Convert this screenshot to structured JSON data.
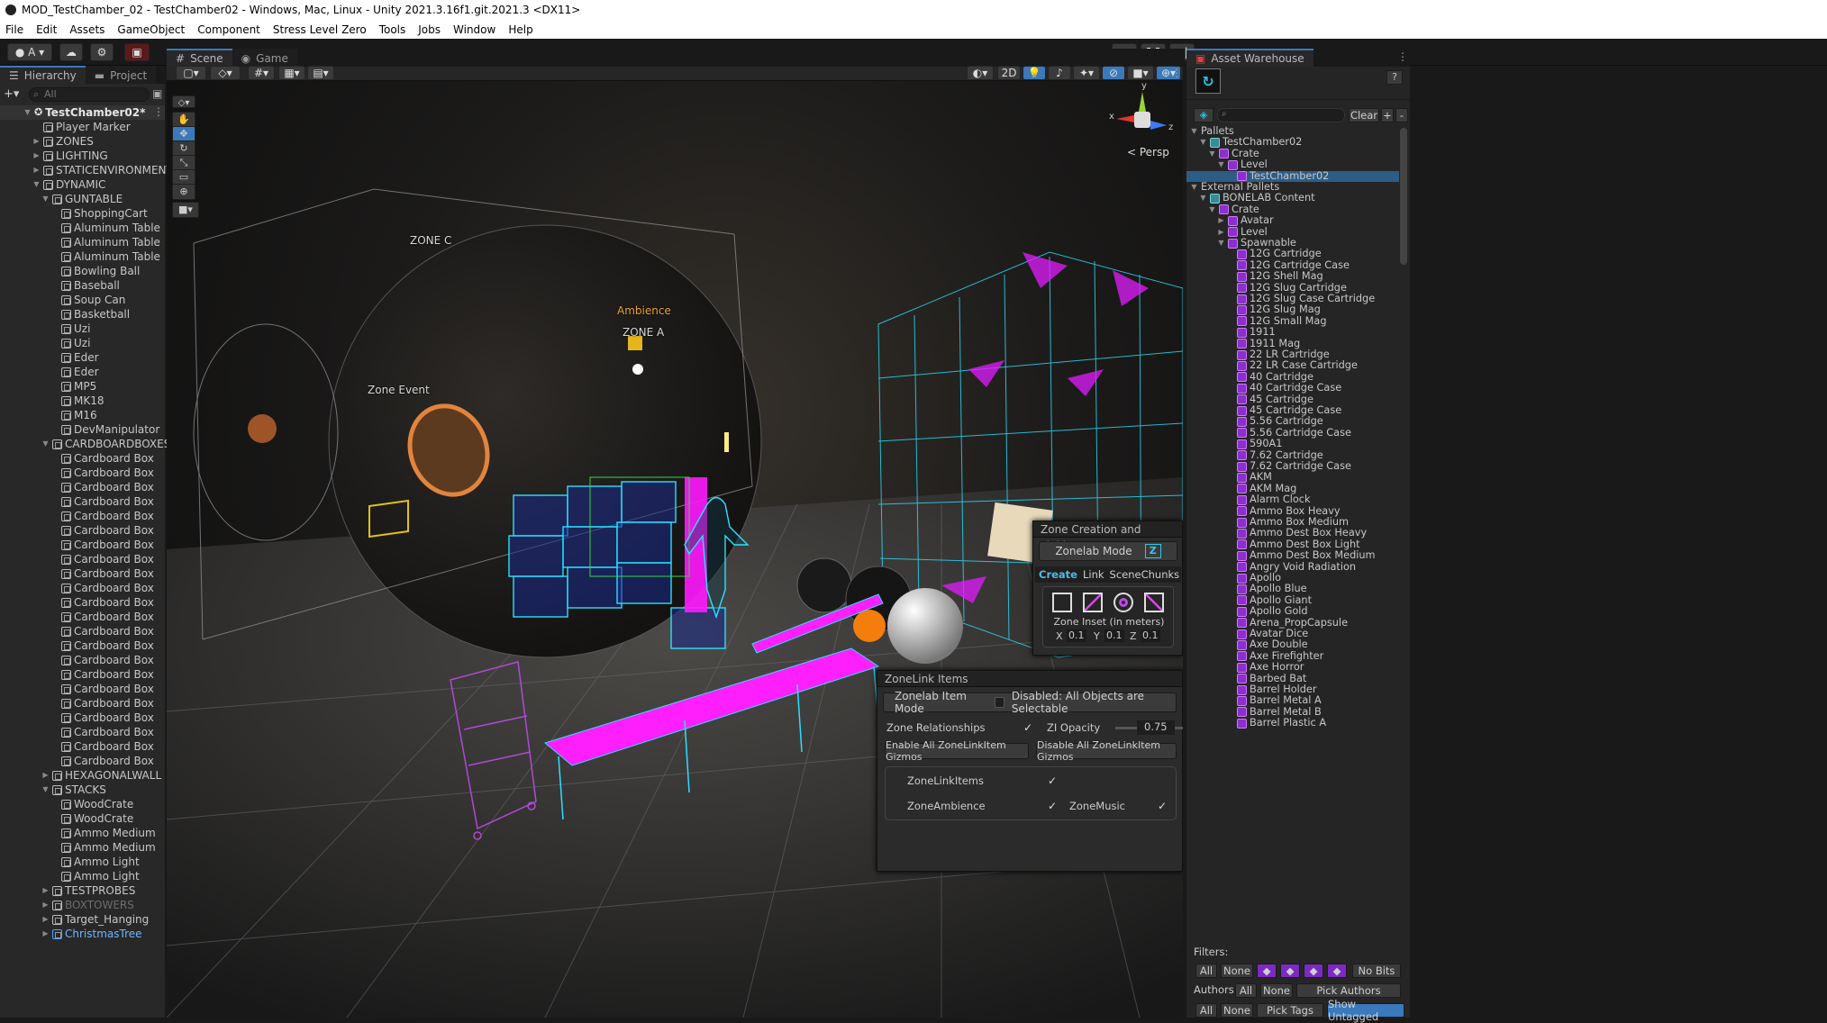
{
  "window": {
    "title": "MOD_TestChamber_02 - TestChamber02 - Windows, Mac, Linux - Unity 2021.3.16f1.git.2021.3 <DX11>"
  },
  "menu": [
    "File",
    "Edit",
    "Assets",
    "GameObject",
    "Component",
    "Stress Level Zero",
    "Tools",
    "Jobs",
    "Window",
    "Help"
  ],
  "toolbar": {
    "account": "A",
    "play": "▶",
    "pause": "❚❚",
    "step": "▶|"
  },
  "left_tabs": {
    "hierarchy": "Hierarchy",
    "project": "Project"
  },
  "hierarchy": {
    "search_placeholder": "All",
    "root": "TestChamber02*",
    "items": [
      {
        "label": "Player Marker",
        "depth": 1,
        "exp": ""
      },
      {
        "label": "ZONES",
        "depth": 1,
        "exp": "▶"
      },
      {
        "label": "LIGHTING",
        "depth": 1,
        "exp": "▶"
      },
      {
        "label": "STATICENVIRONMENT",
        "depth": 1,
        "exp": "▶"
      },
      {
        "label": "DYNAMIC",
        "depth": 1,
        "exp": "▼"
      },
      {
        "label": "GUNTABLE",
        "depth": 2,
        "exp": "▼"
      },
      {
        "label": "ShoppingCart",
        "depth": 3,
        "exp": ""
      },
      {
        "label": "Aluminum Table",
        "depth": 3,
        "exp": ""
      },
      {
        "label": "Aluminum Table",
        "depth": 3,
        "exp": ""
      },
      {
        "label": "Aluminum Table",
        "depth": 3,
        "exp": ""
      },
      {
        "label": "Bowling Ball",
        "depth": 3,
        "exp": ""
      },
      {
        "label": "Baseball",
        "depth": 3,
        "exp": ""
      },
      {
        "label": "Soup Can",
        "depth": 3,
        "exp": ""
      },
      {
        "label": "Basketball",
        "depth": 3,
        "exp": ""
      },
      {
        "label": "Uzi",
        "depth": 3,
        "exp": ""
      },
      {
        "label": "Uzi",
        "depth": 3,
        "exp": ""
      },
      {
        "label": "Eder",
        "depth": 3,
        "exp": ""
      },
      {
        "label": "Eder",
        "depth": 3,
        "exp": ""
      },
      {
        "label": "MP5",
        "depth": 3,
        "exp": ""
      },
      {
        "label": "MK18",
        "depth": 3,
        "exp": ""
      },
      {
        "label": "M16",
        "depth": 3,
        "exp": ""
      },
      {
        "label": "DevManipulator",
        "depth": 3,
        "exp": ""
      },
      {
        "label": "CARDBOARDBOXES",
        "depth": 2,
        "exp": "▼"
      },
      {
        "label": "Cardboard Box",
        "depth": 3,
        "exp": ""
      },
      {
        "label": "Cardboard Box",
        "depth": 3,
        "exp": ""
      },
      {
        "label": "Cardboard Box",
        "depth": 3,
        "exp": ""
      },
      {
        "label": "Cardboard Box",
        "depth": 3,
        "exp": ""
      },
      {
        "label": "Cardboard Box",
        "depth": 3,
        "exp": ""
      },
      {
        "label": "Cardboard Box",
        "depth": 3,
        "exp": ""
      },
      {
        "label": "Cardboard Box",
        "depth": 3,
        "exp": ""
      },
      {
        "label": "Cardboard Box",
        "depth": 3,
        "exp": ""
      },
      {
        "label": "Cardboard Box",
        "depth": 3,
        "exp": ""
      },
      {
        "label": "Cardboard Box",
        "depth": 3,
        "exp": ""
      },
      {
        "label": "Cardboard Box",
        "depth": 3,
        "exp": ""
      },
      {
        "label": "Cardboard Box",
        "depth": 3,
        "exp": ""
      },
      {
        "label": "Cardboard Box",
        "depth": 3,
        "exp": ""
      },
      {
        "label": "Cardboard Box",
        "depth": 3,
        "exp": ""
      },
      {
        "label": "Cardboard Box",
        "depth": 3,
        "exp": ""
      },
      {
        "label": "Cardboard Box",
        "depth": 3,
        "exp": ""
      },
      {
        "label": "Cardboard Box",
        "depth": 3,
        "exp": ""
      },
      {
        "label": "Cardboard Box",
        "depth": 3,
        "exp": ""
      },
      {
        "label": "Cardboard Box",
        "depth": 3,
        "exp": ""
      },
      {
        "label": "Cardboard Box",
        "depth": 3,
        "exp": ""
      },
      {
        "label": "Cardboard Box",
        "depth": 3,
        "exp": ""
      },
      {
        "label": "Cardboard Box",
        "depth": 3,
        "exp": ""
      },
      {
        "label": "HEXAGONALWALL",
        "depth": 2,
        "exp": "▶"
      },
      {
        "label": "STACKS",
        "depth": 2,
        "exp": "▼"
      },
      {
        "label": "WoodCrate",
        "depth": 3,
        "exp": ""
      },
      {
        "label": "WoodCrate",
        "depth": 3,
        "exp": ""
      },
      {
        "label": "Ammo Medium",
        "depth": 3,
        "exp": ""
      },
      {
        "label": "Ammo Medium",
        "depth": 3,
        "exp": ""
      },
      {
        "label": "Ammo Light",
        "depth": 3,
        "exp": ""
      },
      {
        "label": "Ammo Light",
        "depth": 3,
        "exp": ""
      },
      {
        "label": "TESTPROBES",
        "depth": 2,
        "exp": "▶"
      },
      {
        "label": "BOXTOWERS",
        "depth": 2,
        "exp": "▶",
        "dim": true
      },
      {
        "label": "Target_Hanging",
        "depth": 2,
        "exp": "▶"
      },
      {
        "label": "ChristmasTree",
        "depth": 2,
        "exp": "▶",
        "blue": true
      }
    ]
  },
  "center_tabs": {
    "scene": "Scene",
    "game": "Game"
  },
  "scene_toolbar": {
    "mode2d": "2D"
  },
  "scene_labels": {
    "zone_c": "ZONE C",
    "ambience": "Ambience",
    "zone_a": "ZONE A",
    "zone_event": "Zone Event",
    "persp": "< Persp"
  },
  "gizmo_axes": {
    "x": "x",
    "y": "y",
    "z": "z"
  },
  "zone_creation": {
    "title": "Zone Creation and Linking",
    "mode_button": "Zonelab Mode",
    "tabs": [
      "Create",
      "Link",
      "SceneChunks"
    ],
    "inset_label": "Zone Inset (in meters)",
    "x_label": "X",
    "x_value": "0.1",
    "y_label": "Y",
    "y_value": "0.1",
    "z_label": "Z",
    "z_value": "0.1"
  },
  "zonelink": {
    "title": "ZoneLink Items",
    "item_mode_button": "Zonelab Item Mode",
    "disabled_text": "Disabled: All Objects are Selectable",
    "relationships_label": "Zone Relationships",
    "opacity_label": "ZI Opacity",
    "opacity_value": "0.75",
    "opacity_fraction": 0.75,
    "enable_button": "Enable All ZoneLinkItem Gizmos",
    "disable_button": "Disable All ZoneLinkItem Gizmos",
    "items_label": "ZoneLinkItems",
    "ambience_label": "ZoneAmbience",
    "music_label": "ZoneMusic"
  },
  "asset_warehouse": {
    "tab": "Asset Warehouse",
    "help": "?",
    "clear_button": "Clear",
    "plus": "+",
    "minus": "-",
    "tree": [
      {
        "label": "Pallets",
        "depth": 0,
        "exp": "▼",
        "icon": ""
      },
      {
        "label": "TestChamber02",
        "depth": 1,
        "exp": "▼",
        "icon": "c"
      },
      {
        "label": "Crate",
        "depth": 2,
        "exp": "▼",
        "icon": "p"
      },
      {
        "label": "Level",
        "depth": 3,
        "exp": "▼",
        "icon": "p"
      },
      {
        "label": "TestChamber02",
        "depth": 4,
        "exp": "",
        "icon": "p",
        "sel": true
      },
      {
        "label": "External Pallets",
        "depth": 0,
        "exp": "▼",
        "icon": ""
      },
      {
        "label": "BONELAB Content",
        "depth": 1,
        "exp": "▼",
        "icon": "c"
      },
      {
        "label": "Crate",
        "depth": 2,
        "exp": "▼",
        "icon": "p"
      },
      {
        "label": "Avatar",
        "depth": 3,
        "exp": "▶",
        "icon": "p"
      },
      {
        "label": "Level",
        "depth": 3,
        "exp": "▶",
        "icon": "p"
      },
      {
        "label": "Spawnable",
        "depth": 3,
        "exp": "▼",
        "icon": "p"
      },
      {
        "label": "12G Cartridge",
        "depth": 4,
        "exp": "",
        "icon": "p"
      },
      {
        "label": "12G Cartridge Case",
        "depth": 4,
        "exp": "",
        "icon": "p"
      },
      {
        "label": "12G Shell Mag",
        "depth": 4,
        "exp": "",
        "icon": "p"
      },
      {
        "label": "12G Slug Cartridge",
        "depth": 4,
        "exp": "",
        "icon": "p"
      },
      {
        "label": "12G Slug Case Cartridge",
        "depth": 4,
        "exp": "",
        "icon": "p"
      },
      {
        "label": "12G Slug Mag",
        "depth": 4,
        "exp": "",
        "icon": "p"
      },
      {
        "label": "12G Small Mag",
        "depth": 4,
        "exp": "",
        "icon": "p"
      },
      {
        "label": "1911",
        "depth": 4,
        "exp": "",
        "icon": "p"
      },
      {
        "label": "1911 Mag",
        "depth": 4,
        "exp": "",
        "icon": "p"
      },
      {
        "label": "22 LR Cartridge",
        "depth": 4,
        "exp": "",
        "icon": "p"
      },
      {
        "label": "22 LR Case Cartridge",
        "depth": 4,
        "exp": "",
        "icon": "p"
      },
      {
        "label": "40 Cartridge",
        "depth": 4,
        "exp": "",
        "icon": "p"
      },
      {
        "label": "40 Cartridge Case",
        "depth": 4,
        "exp": "",
        "icon": "p"
      },
      {
        "label": "45 Cartridge",
        "depth": 4,
        "exp": "",
        "icon": "p"
      },
      {
        "label": "45 Cartridge Case",
        "depth": 4,
        "exp": "",
        "icon": "p"
      },
      {
        "label": "5.56 Cartridge",
        "depth": 4,
        "exp": "",
        "icon": "p"
      },
      {
        "label": "5.56 Cartridge Case",
        "depth": 4,
        "exp": "",
        "icon": "p"
      },
      {
        "label": "590A1",
        "depth": 4,
        "exp": "",
        "icon": "p"
      },
      {
        "label": "7.62 Cartridge",
        "depth": 4,
        "exp": "",
        "icon": "p"
      },
      {
        "label": "7.62 Cartridge Case",
        "depth": 4,
        "exp": "",
        "icon": "p"
      },
      {
        "label": "AKM",
        "depth": 4,
        "exp": "",
        "icon": "p"
      },
      {
        "label": "AKM Mag",
        "depth": 4,
        "exp": "",
        "icon": "p"
      },
      {
        "label": "Alarm Clock",
        "depth": 4,
        "exp": "",
        "icon": "p"
      },
      {
        "label": "Ammo Box Heavy",
        "depth": 4,
        "exp": "",
        "icon": "p"
      },
      {
        "label": "Ammo Box Medium",
        "depth": 4,
        "exp": "",
        "icon": "p"
      },
      {
        "label": "Ammo Dest Box Heavy",
        "depth": 4,
        "exp": "",
        "icon": "p"
      },
      {
        "label": "Ammo Dest Box Light",
        "depth": 4,
        "exp": "",
        "icon": "p"
      },
      {
        "label": "Ammo Dest Box Medium",
        "depth": 4,
        "exp": "",
        "icon": "p"
      },
      {
        "label": "Angry Void Radiation",
        "depth": 4,
        "exp": "",
        "icon": "p"
      },
      {
        "label": "Apollo",
        "depth": 4,
        "exp": "",
        "icon": "p"
      },
      {
        "label": "Apollo Blue",
        "depth": 4,
        "exp": "",
        "icon": "p"
      },
      {
        "label": "Apollo Giant",
        "depth": 4,
        "exp": "",
        "icon": "p"
      },
      {
        "label": "Apollo Gold",
        "depth": 4,
        "exp": "",
        "icon": "p"
      },
      {
        "label": "Arena_PropCapsule",
        "depth": 4,
        "exp": "",
        "icon": "p"
      },
      {
        "label": "Avatar Dice",
        "depth": 4,
        "exp": "",
        "icon": "p"
      },
      {
        "label": "Axe Double",
        "depth": 4,
        "exp": "",
        "icon": "p"
      },
      {
        "label": "Axe Firefighter",
        "depth": 4,
        "exp": "",
        "icon": "p"
      },
      {
        "label": "Axe Horror",
        "depth": 4,
        "exp": "",
        "icon": "p"
      },
      {
        "label": "Barbed Bat",
        "depth": 4,
        "exp": "",
        "icon": "p"
      },
      {
        "label": "Barrel Holder",
        "depth": 4,
        "exp": "",
        "icon": "p"
      },
      {
        "label": "Barrel Metal A",
        "depth": 4,
        "exp": "",
        "icon": "p"
      },
      {
        "label": "Barrel Metal B",
        "depth": 4,
        "exp": "",
        "icon": "p"
      },
      {
        "label": "Barrel Plastic A",
        "depth": 4,
        "exp": "",
        "icon": "p"
      }
    ],
    "filters_label": "Filters:",
    "filter_all": "All",
    "filter_none": "None",
    "filter_nobits": "No Bits",
    "authors_label": "Authors:",
    "authors_all": "All",
    "authors_none": "None",
    "pick_authors": "Pick Authors",
    "tags_all": "All",
    "tags_none": "None",
    "pick_tags": "Pick Tags",
    "show_untagged": "Show Untagged"
  },
  "colors": {
    "accent": "#3a79bb",
    "pallet": "#8d2ed0",
    "magenta": "#ff19ff",
    "cyan": "#28e0ff"
  }
}
